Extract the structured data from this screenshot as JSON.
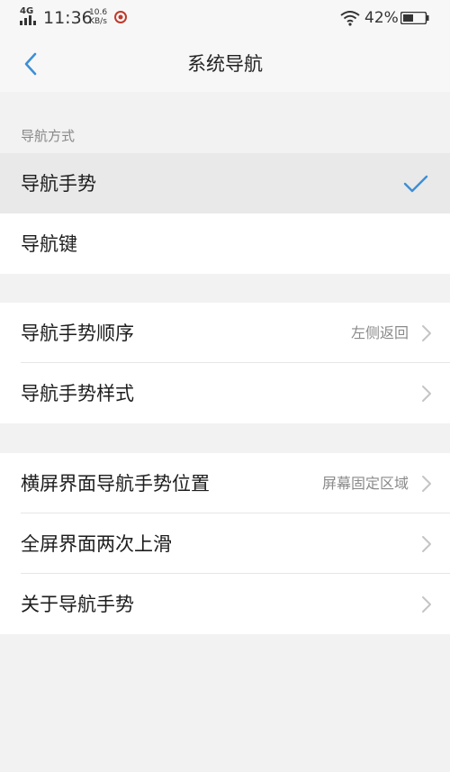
{
  "status_bar": {
    "network": "4G",
    "time": "11:36",
    "speed_value": "10.6",
    "speed_unit": "KB/s",
    "battery_percent": "42%"
  },
  "header": {
    "title": "系统导航"
  },
  "nav_mode_section": {
    "header": "导航方式",
    "options": [
      {
        "label": "导航手势",
        "selected": true
      },
      {
        "label": "导航键",
        "selected": false
      }
    ]
  },
  "gesture_group": {
    "items": [
      {
        "label": "导航手势顺序",
        "value": "左侧返回"
      },
      {
        "label": "导航手势样式",
        "value": ""
      }
    ]
  },
  "more_group": {
    "items": [
      {
        "label": "横屏界面导航手势位置",
        "value": "屏幕固定区域"
      },
      {
        "label": "全屏界面两次上滑",
        "value": ""
      },
      {
        "label": "关于导航手势",
        "value": ""
      }
    ]
  },
  "colors": {
    "accent": "#3d8fd6",
    "background": "#f2f2f2",
    "selected_row": "#e9e9e9"
  }
}
